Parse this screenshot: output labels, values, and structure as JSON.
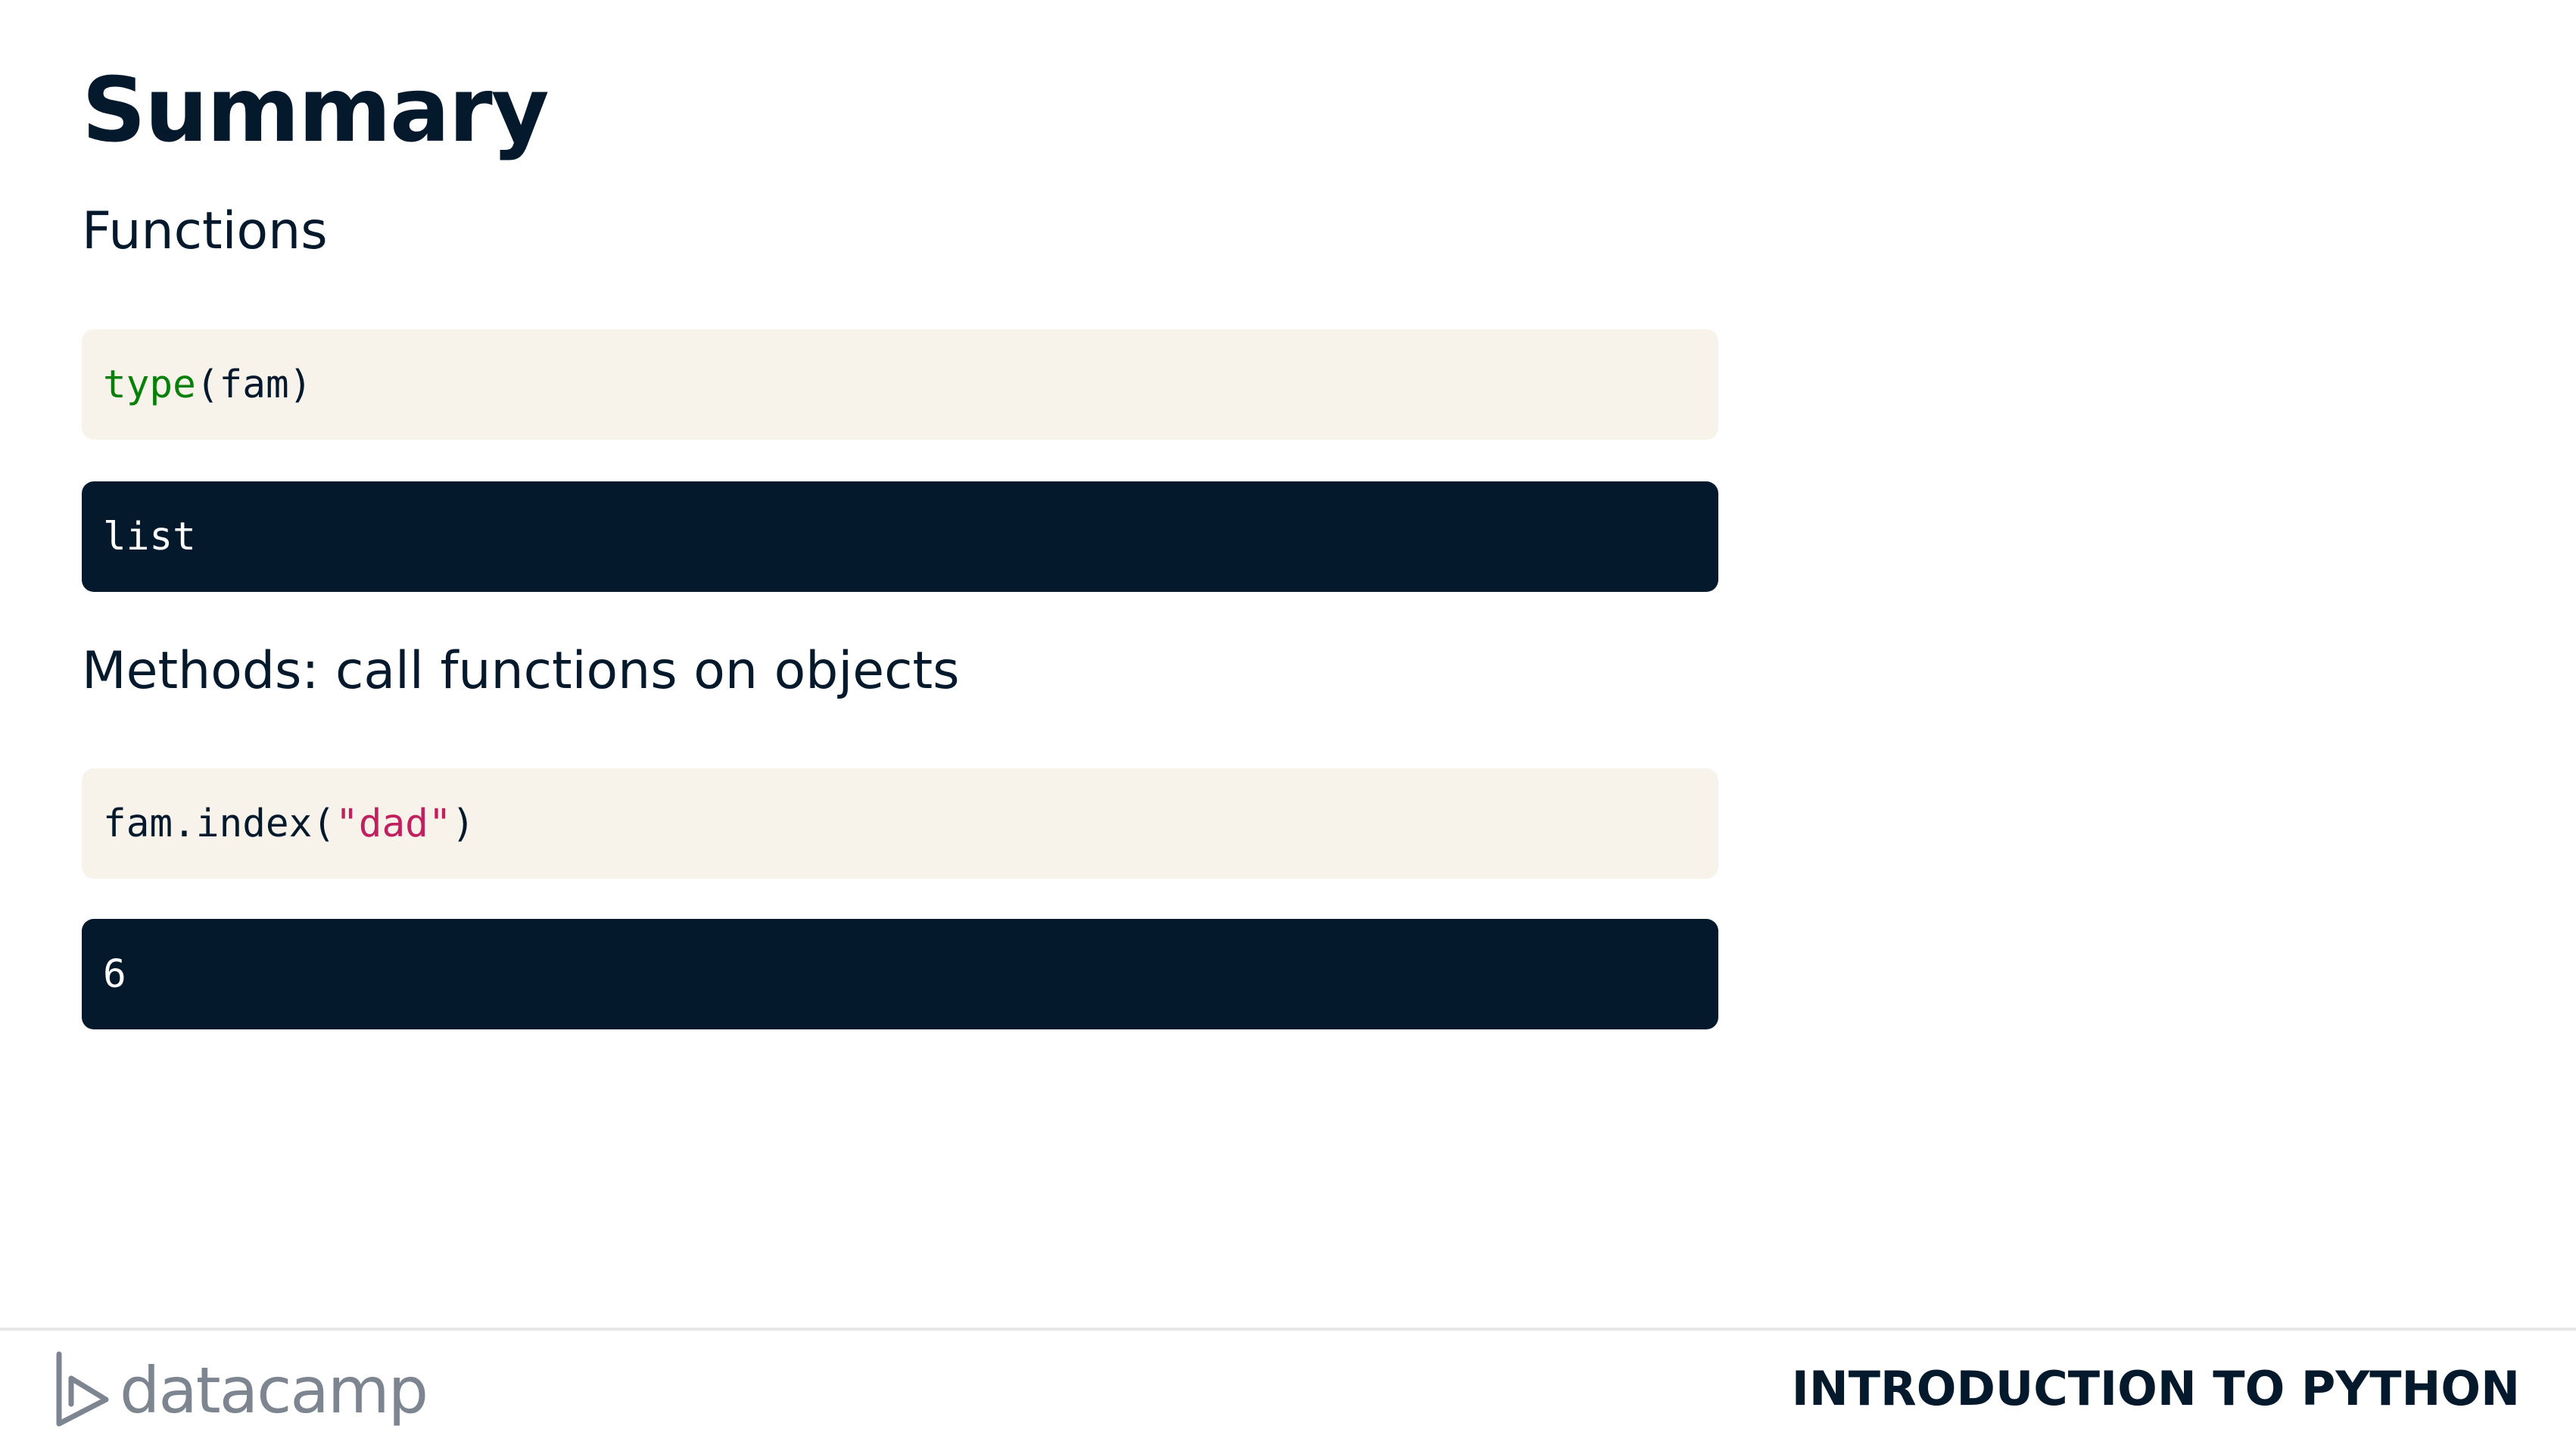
{
  "slide": {
    "title": "Summary"
  },
  "sections": {
    "functions_heading": "Functions",
    "functions_code": {
      "builtin": "type",
      "rest": "(fam)"
    },
    "functions_output": "list",
    "methods_heading": "Methods: call functions on objects",
    "methods_code": {
      "prefix": "fam.index(",
      "string": "\"dad\"",
      "suffix": ")"
    },
    "methods_output": "6"
  },
  "footer": {
    "logo_text": "datacamp",
    "logo_icon": "datacamp-logo-icon",
    "course_title": "INTRODUCTION TO PYTHON"
  },
  "colors": {
    "navy": "#05192d",
    "code_input_bg": "#f7f3eb",
    "builtin_green": "#068008",
    "string_pink": "#c1205e",
    "logo_gray": "#7d8590"
  }
}
